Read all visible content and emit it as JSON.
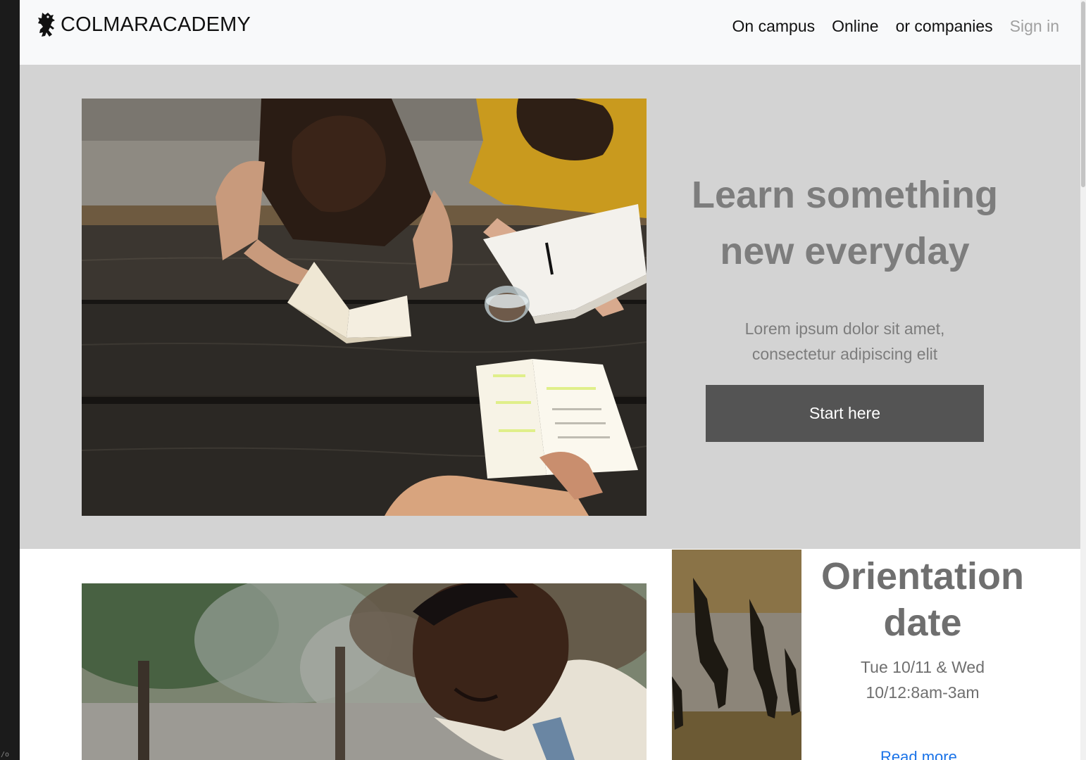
{
  "brand": {
    "name": "COLMARACADEMY",
    "logo_icon": "lion-rampant-icon"
  },
  "nav": {
    "links": [
      "On campus",
      "Online",
      "or companies"
    ],
    "sign_in": "Sign in"
  },
  "hero": {
    "title_line1": "Learn something",
    "title_line2": "new everyday",
    "subtitle": "Lorem ipsum dolor sit amet, consectetur adipiscing elit",
    "button_label": "Start here",
    "image": "students-studying-at-table"
  },
  "orientation": {
    "title": "Orientation date",
    "date": "Tue 10/11 & Wed 10/12:8am-3am",
    "link_label": "Read more",
    "image_main": "student-smiling-outdoors",
    "image_side": "shadows-on-ground"
  },
  "colors": {
    "navbar_bg": "#f8f9fa",
    "hero_bg": "#d3d3d3",
    "button_bg": "#545454",
    "heading_text": "#7d7d7d",
    "link": "#1a73e8"
  }
}
